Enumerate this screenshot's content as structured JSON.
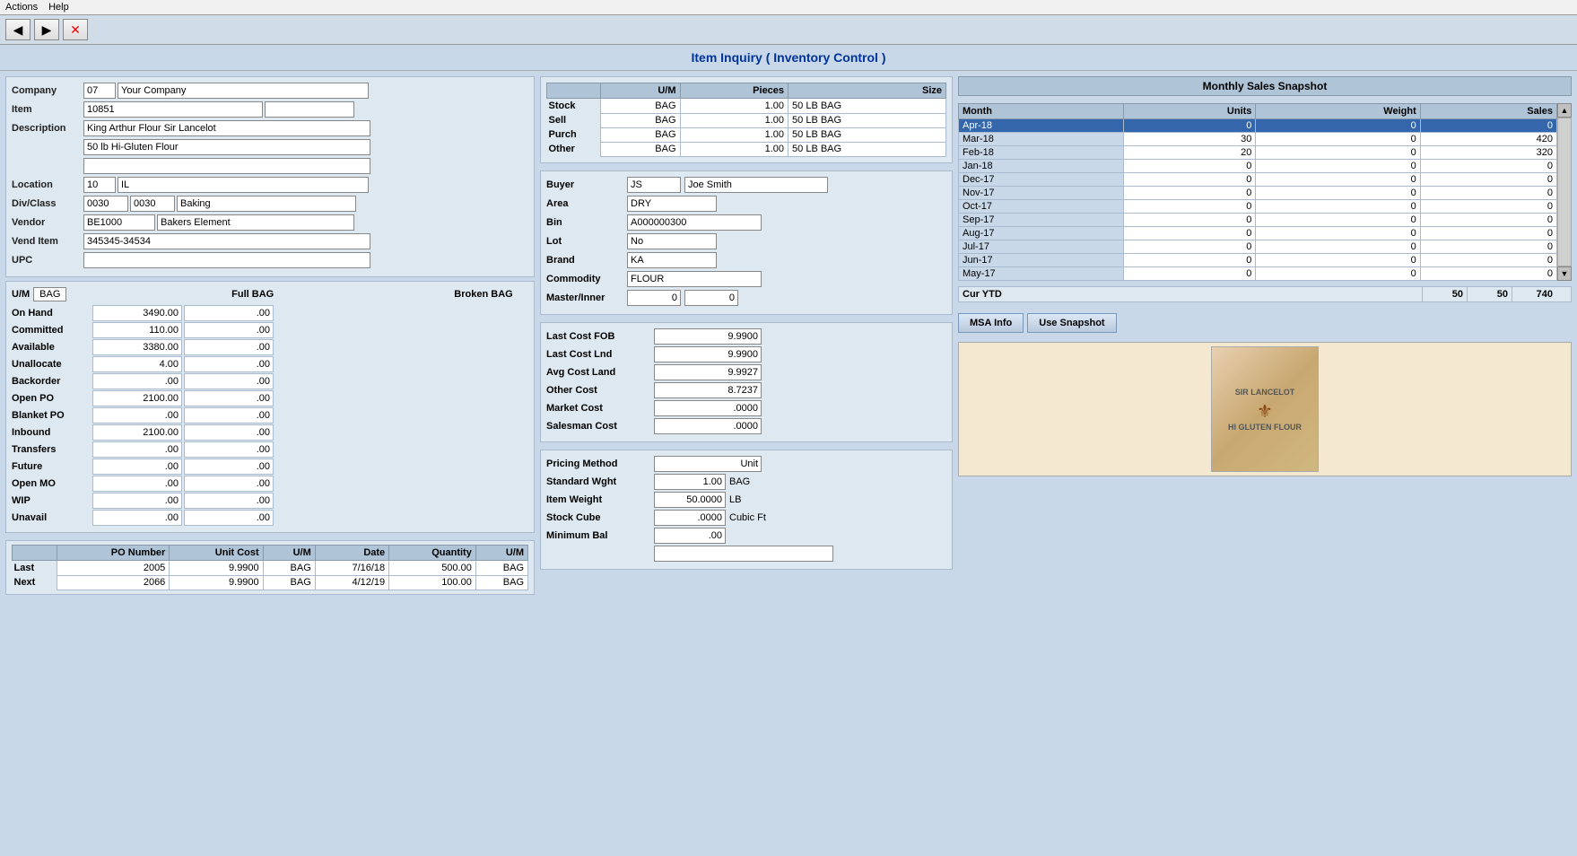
{
  "menubar": {
    "items": [
      "Actions",
      "Help"
    ]
  },
  "toolbar": {
    "back_label": "◀",
    "forward_label": "▶",
    "stop_label": "✕"
  },
  "title": "Item Inquiry ( Inventory Control )",
  "left": {
    "company_label": "Company",
    "company_code": "07",
    "company_name": "Your Company",
    "item_label": "Item",
    "item_code": "10851",
    "item_extra": "",
    "description_label": "Description",
    "desc1": "King Arthur Flour Sir Lancelot",
    "desc2": "50 lb Hi-Gluten Flour",
    "desc3": "",
    "location_label": "Location",
    "location_code": "10",
    "location_name": "IL",
    "divclass_label": "Div/Class",
    "div_code": "0030",
    "class_code": "0030",
    "class_name": "Baking",
    "vendor_label": "Vendor",
    "vendor_code": "BE1000",
    "vendor_name": "Bakers Element",
    "vend_item_label": "Vend Item",
    "vend_item": "345345-34534",
    "upc_label": "UPC",
    "upc": ""
  },
  "um_section": {
    "um_label": "U/M",
    "um_value": "BAG",
    "col_headers": [
      "Full BAG",
      "Broken BAG"
    ],
    "rows": [
      {
        "label": "On Hand",
        "full": "3490.00",
        "broken": ".00"
      },
      {
        "label": "Committed",
        "full": "110.00",
        "broken": ".00"
      },
      {
        "label": "Available",
        "full": "3380.00",
        "broken": ".00"
      },
      {
        "label": "Unallocate",
        "full": "4.00",
        "broken": ".00"
      },
      {
        "label": "Backorder",
        "full": ".00",
        "broken": ".00"
      },
      {
        "label": "Open PO",
        "full": "2100.00",
        "broken": ".00"
      },
      {
        "label": "Blanket PO",
        "full": ".00",
        "broken": ".00"
      },
      {
        "label": "Inbound",
        "full": "2100.00",
        "broken": ".00"
      },
      {
        "label": "Transfers",
        "full": ".00",
        "broken": ".00"
      },
      {
        "label": "Future",
        "full": ".00",
        "broken": ".00"
      },
      {
        "label": "Open MO",
        "full": ".00",
        "broken": ".00"
      },
      {
        "label": "WIP",
        "full": ".00",
        "broken": ".00"
      },
      {
        "label": "Unavail",
        "full": ".00",
        "broken": ".00"
      }
    ]
  },
  "po_section": {
    "col_headers": [
      "PO Number",
      "Unit Cost",
      "U/M",
      "Date",
      "Quantity",
      "U/M"
    ],
    "last_label": "Last",
    "next_label": "Next",
    "last_row": {
      "po_number": "2005",
      "unit_cost": "9.9900",
      "um": "BAG",
      "date": "7/16/18",
      "quantity": "500.00",
      "um2": "BAG"
    },
    "next_row": {
      "po_number": "2066",
      "unit_cost": "9.9900",
      "um": "BAG",
      "date": "4/12/19",
      "quantity": "100.00",
      "um2": "BAG"
    }
  },
  "uom_section": {
    "title": "",
    "col_headers": [
      "U/M",
      "Pieces",
      "Size"
    ],
    "rows": [
      {
        "label": "Stock",
        "um": "BAG",
        "pieces": "1.00",
        "size": "50 LB BAG"
      },
      {
        "label": "Sell",
        "um": "BAG",
        "pieces": "1.00",
        "size": "50 LB BAG"
      },
      {
        "label": "Purch",
        "um": "BAG",
        "pieces": "1.00",
        "size": "50 LB BAG"
      },
      {
        "label": "Other",
        "um": "BAG",
        "pieces": "1.00",
        "size": "50 LB BAG"
      }
    ]
  },
  "buyer_section": {
    "buyer_label": "Buyer",
    "buyer_code": "JS",
    "buyer_name": "Joe Smith",
    "area_label": "Area",
    "area_value": "DRY",
    "bin_label": "Bin",
    "bin_value": "A000000300",
    "lot_label": "Lot",
    "lot_value": "No",
    "brand_label": "Brand",
    "brand_value": "KA",
    "commodity_label": "Commodity",
    "commodity_value": "FLOUR",
    "master_label": "Master/Inner",
    "master_val1": "0",
    "master_val2": "0"
  },
  "cost_section": {
    "last_cost_fob_label": "Last Cost FOB",
    "last_cost_fob": "9.9900",
    "last_cost_lnd_label": "Last Cost Lnd",
    "last_cost_lnd": "9.9900",
    "avg_cost_land_label": "Avg Cost Land",
    "avg_cost_land": "9.9927",
    "other_cost_label": "Other Cost",
    "other_cost": "8.7237",
    "market_cost_label": "Market Cost",
    "market_cost": ".0000",
    "salesman_cost_label": "Salesman Cost",
    "salesman_cost": ".0000"
  },
  "pricing_section": {
    "pricing_method_label": "Pricing Method",
    "pricing_method": "Unit",
    "standard_wght_label": "Standard Wght",
    "standard_wght": "1.00",
    "standard_wght_um": "BAG",
    "item_weight_label": "Item Weight",
    "item_weight": "50.0000",
    "item_weight_unit": "LB",
    "stock_cube_label": "Stock Cube",
    "stock_cube": ".0000",
    "stock_cube_unit": "Cubic Ft",
    "minimum_bal_label": "Minimum Bal",
    "minimum_bal": ".00",
    "extra_field": ""
  },
  "snapshot": {
    "title": "Monthly Sales Snapshot",
    "col_headers": [
      "Month",
      "Units",
      "Weight",
      "Sales"
    ],
    "rows": [
      {
        "month": "Apr-18",
        "units": "0",
        "weight": "0",
        "sales": "0",
        "highlight": true
      },
      {
        "month": "Mar-18",
        "units": "30",
        "weight": "0",
        "sales": "420"
      },
      {
        "month": "Feb-18",
        "units": "20",
        "weight": "0",
        "sales": "320"
      },
      {
        "month": "Jan-18",
        "units": "0",
        "weight": "0",
        "sales": "0"
      },
      {
        "month": "Dec-17",
        "units": "0",
        "weight": "0",
        "sales": "0"
      },
      {
        "month": "Nov-17",
        "units": "0",
        "weight": "0",
        "sales": "0"
      },
      {
        "month": "Oct-17",
        "units": "0",
        "weight": "0",
        "sales": "0"
      },
      {
        "month": "Sep-17",
        "units": "0",
        "weight": "0",
        "sales": "0"
      },
      {
        "month": "Aug-17",
        "units": "0",
        "weight": "0",
        "sales": "0"
      },
      {
        "month": "Jul-17",
        "units": "0",
        "weight": "0",
        "sales": "0"
      },
      {
        "month": "Jun-17",
        "units": "0",
        "weight": "0",
        "sales": "0"
      },
      {
        "month": "May-17",
        "units": "0",
        "weight": "0",
        "sales": "0"
      }
    ],
    "ytd_label": "Cur YTD",
    "ytd_units": "50",
    "ytd_weight": "50",
    "ytd_sales": "740",
    "btn_msa_info": "MSA Info",
    "btn_use_snapshot": "Use Snapshot"
  },
  "product_image": {
    "line1": "SIR LANCELOT",
    "line2": "HI GLUTEN FLOUR"
  }
}
